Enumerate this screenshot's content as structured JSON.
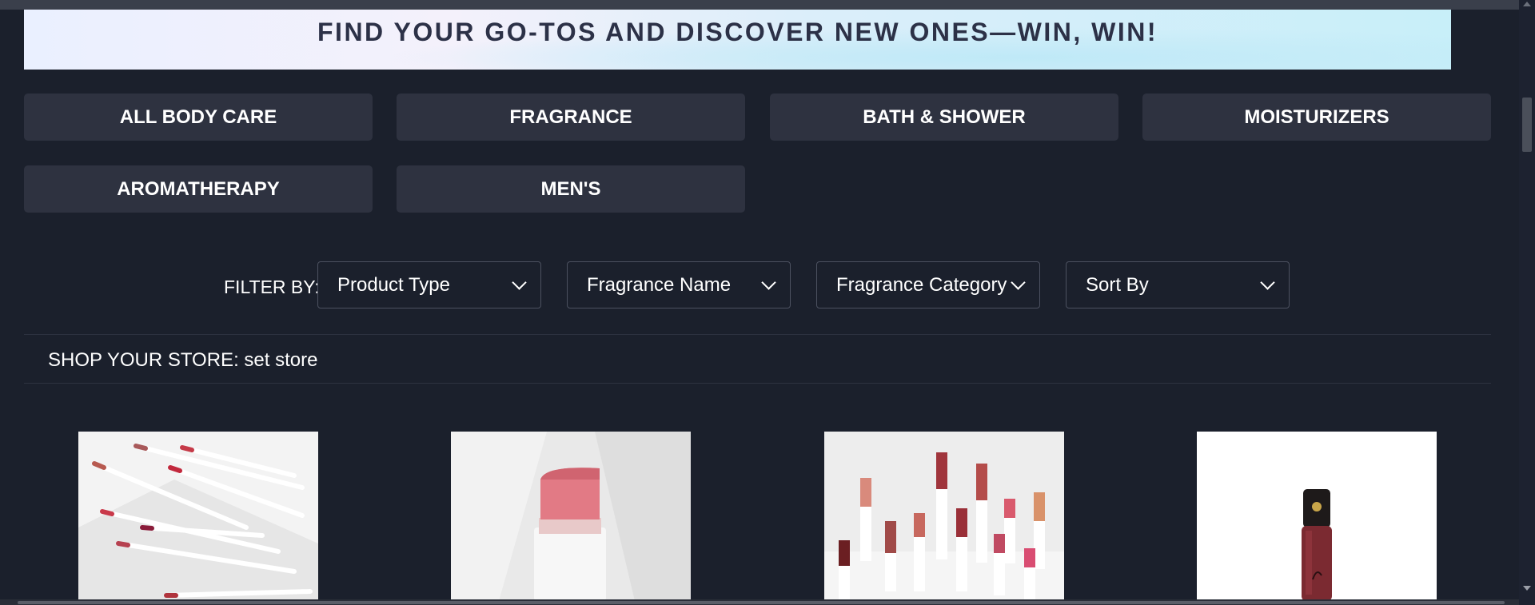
{
  "banner": {
    "text": "FIND YOUR GO-TOS AND DISCOVER NEW ONES—WIN, WIN!"
  },
  "categories": [
    {
      "label": "ALL BODY CARE"
    },
    {
      "label": "FRAGRANCE"
    },
    {
      "label": "BATH & SHOWER"
    },
    {
      "label": "MOISTURIZERS"
    },
    {
      "label": "AROMATHERAPY"
    },
    {
      "label": "MEN'S"
    }
  ],
  "filters": {
    "label": "FILTER BY:",
    "dropdowns": [
      {
        "label": "Product Type"
      },
      {
        "label": "Fragrance Name"
      },
      {
        "label": "Fragrance Category"
      },
      {
        "label": "Sort By"
      }
    ]
  },
  "store": {
    "label": "SHOP YOUR STORE:",
    "link": "set store"
  },
  "products": [
    {
      "image": "lip liner pencils"
    },
    {
      "image": "pink lipstick"
    },
    {
      "image": "lipstick collection"
    },
    {
      "image": "liquid lipstick"
    }
  ],
  "colors": {
    "background": "#1b202c",
    "button": "#2e3240",
    "text": "#ffffff"
  }
}
